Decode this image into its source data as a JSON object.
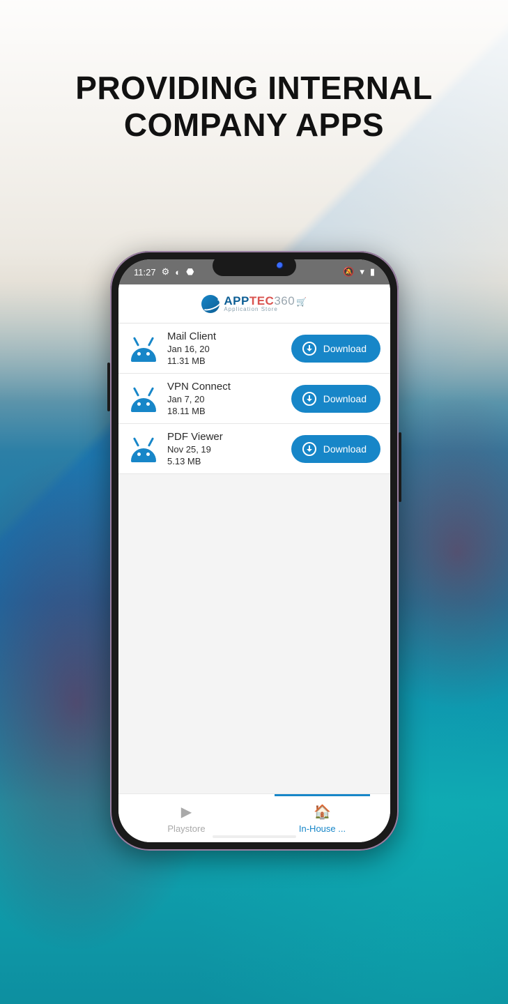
{
  "headline_line1": "PROVIDING INTERNAL",
  "headline_line2": "COMPANY APPS",
  "statusbar": {
    "time": "11:27"
  },
  "brand": {
    "part1": "APP",
    "part2": "TEC",
    "part3": "360",
    "sub": "Application Store"
  },
  "download_label": "Download",
  "apps": [
    {
      "name": "Mail Client",
      "date": "Jan 16, 20",
      "size": "11.31 MB"
    },
    {
      "name": "VPN Connect",
      "date": "Jan 7, 20",
      "size": "18.11 MB"
    },
    {
      "name": "PDF Viewer",
      "date": "Nov 25, 19",
      "size": "5.13 MB"
    }
  ],
  "tabs": {
    "playstore": "Playstore",
    "inhouse": "In-House ..."
  }
}
